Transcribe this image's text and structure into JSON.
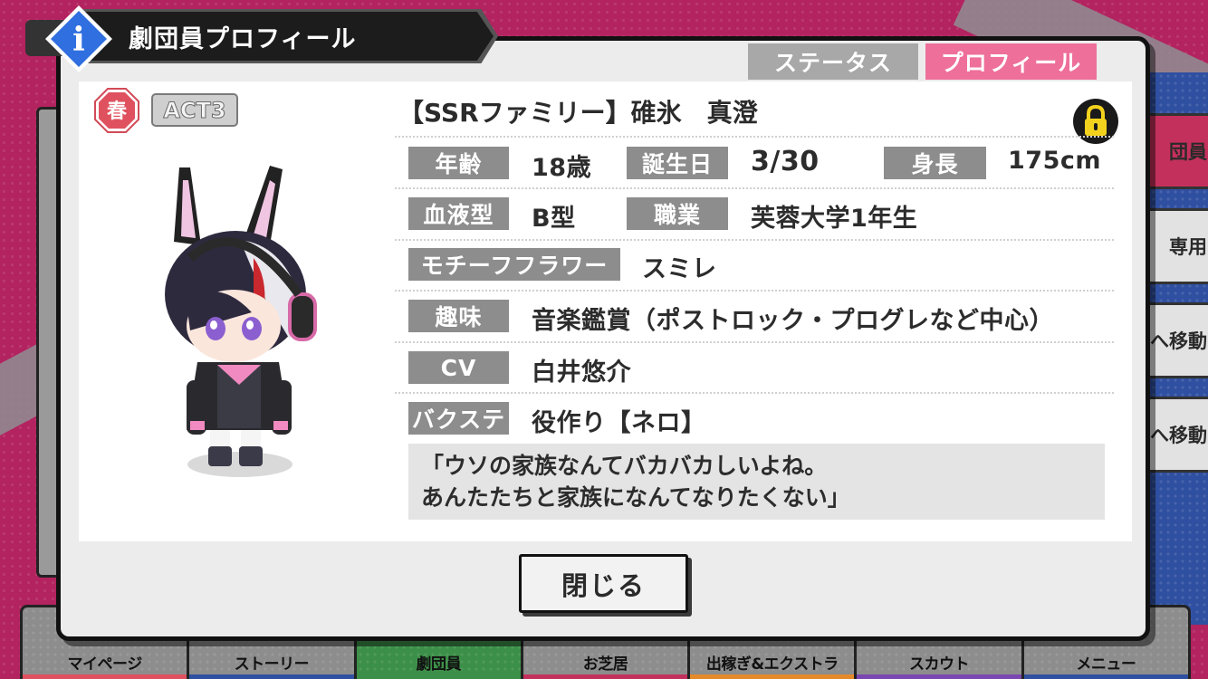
{
  "header": {
    "title": "劇団員プロフィール",
    "info_glyph": "i"
  },
  "tabs": [
    {
      "label": "ステータス",
      "active": false
    },
    {
      "label": "プロフィール",
      "active": true
    }
  ],
  "badges": {
    "season": "春",
    "act": "ACT3",
    "season_color": "#e0515f"
  },
  "card": {
    "title": "【SSRファミリー】碓氷　真澄"
  },
  "profile": {
    "age_label": "年齢",
    "age_value": "18歳",
    "birthday_label": "誕生日",
    "birthday_value": "3/30",
    "height_label": "身長",
    "height_value": "175cm",
    "blood_label": "血液型",
    "blood_value": "B型",
    "job_label": "職業",
    "job_value": "芙蓉大学1年生",
    "flower_label": "モチーフフラワー",
    "flower_value": "スミレ",
    "hobby_label": "趣味",
    "hobby_value": "音楽鑑賞（ポストロック・プログレなど中心）",
    "cv_label": "CV",
    "cv_value": "白井悠介",
    "backstage_label": "バクステ",
    "backstage_value": "役作り【ネロ】"
  },
  "quote": {
    "line1": "「ウソの家族なんてバカバカしいよね。",
    "line2": "あんたたちと家族になんてなりたくない」"
  },
  "close_button": "閉じる",
  "side_tabs": [
    "団員",
    "専用",
    "へ移動",
    "へ移動"
  ],
  "bottom_nav": [
    {
      "label": "マイページ",
      "color": "#e0515f"
    },
    {
      "label": "ストーリー",
      "color": "#2f4fa0"
    },
    {
      "label": "劇団員",
      "color": "#3c8f48"
    },
    {
      "label": "お芝居",
      "color": "#c4305c"
    },
    {
      "label": "出稼ぎ&エクストラ",
      "color": "#e58a2a"
    },
    {
      "label": "スカウト",
      "color": "#7a46b0"
    },
    {
      "label": "メニュー",
      "color": "#2f4fa0"
    }
  ],
  "icons": {
    "lock": "lock-icon",
    "info": "info-icon"
  },
  "colors": {
    "accent_pink": "#ee6f9a",
    "label_gray": "#8d8d8d",
    "lock_yellow": "#f3d21e"
  }
}
